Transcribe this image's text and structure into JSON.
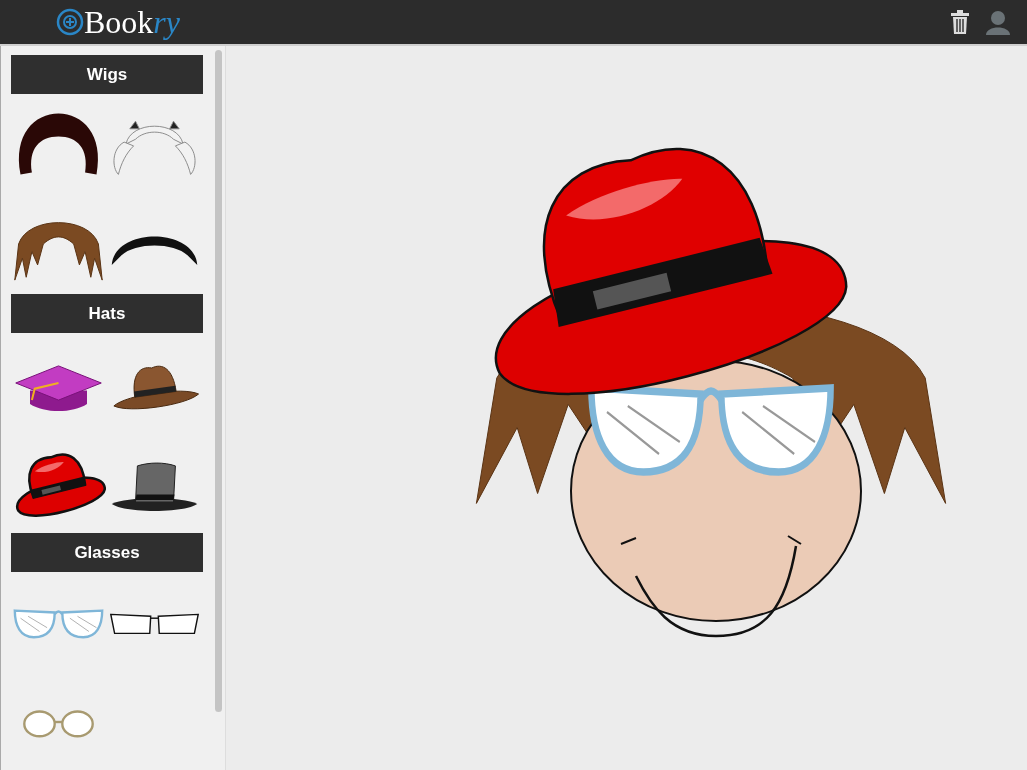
{
  "header": {
    "logo": {
      "main": "Book",
      "accent": "ry"
    }
  },
  "sidebar": {
    "sections": [
      {
        "title": "Wigs",
        "items": [
          {
            "kind": "bob"
          },
          {
            "kind": "pigtails"
          },
          {
            "kind": "shaggy"
          },
          {
            "kind": "flat"
          }
        ]
      },
      {
        "title": "Hats",
        "items": [
          {
            "kind": "mortarboard"
          },
          {
            "kind": "cowboy"
          },
          {
            "kind": "fedora"
          },
          {
            "kind": "tophat"
          }
        ]
      },
      {
        "title": "Glasses",
        "items": [
          {
            "kind": "catseye"
          },
          {
            "kind": "rectangle"
          },
          {
            "kind": "round"
          }
        ]
      }
    ]
  },
  "canvas": {
    "layers": [
      {
        "kind": "shaggy"
      },
      {
        "kind": "catseye"
      },
      {
        "kind": "fedora"
      }
    ]
  }
}
